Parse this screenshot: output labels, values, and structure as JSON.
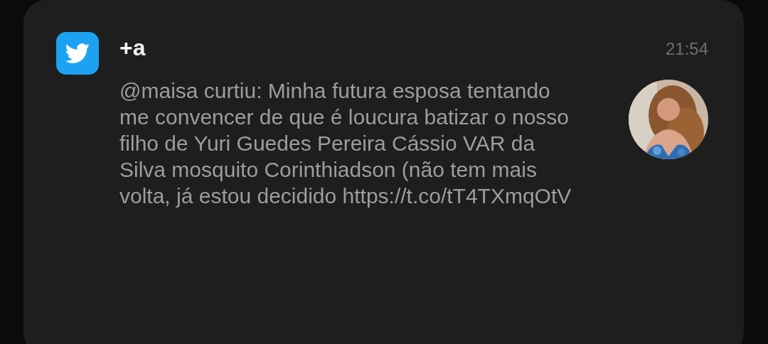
{
  "notification": {
    "app": "+a",
    "time": "21:54",
    "message": "@maisa curtiu: Minha futura esposa tentando me convencer de que é loucura batizar o nosso filho de Yuri Guedes Pereira Cássio VAR da Silva mosquito Corinthiadson (não tem mais volta, já estou decidido https://t.co/tT4TXmqOtV"
  }
}
